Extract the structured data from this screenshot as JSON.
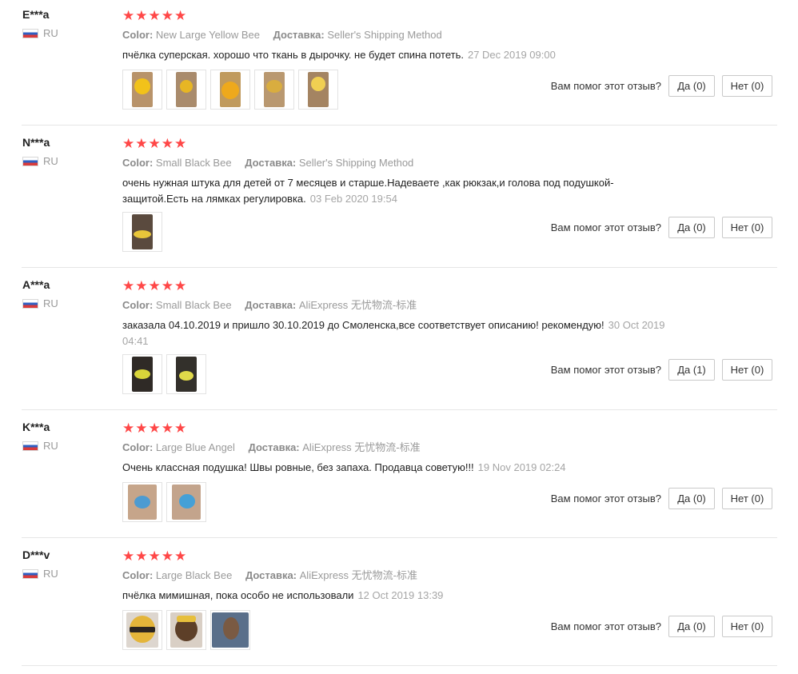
{
  "labels": {
    "color": "Color:",
    "shipping": "Доставка:",
    "helpful_question": "Вам помог этот отзыв?",
    "stars": "★★★★★"
  },
  "colors": {
    "star": "#ff4747",
    "divider": "#e6e6e6",
    "muted": "#9a9a9a"
  },
  "reviews": [
    {
      "user": "E***a",
      "country": "RU",
      "color_value": "New Large Yellow Bee",
      "shipping_value": "Seller's Shipping Method",
      "text": "пчёлка суперская. хорошо что ткань в дырочку. не будет спина потеть.",
      "date": "27 Dec 2019 09:00",
      "yes": "Да (0)",
      "no": "Нет (0)",
      "photos": 5
    },
    {
      "user": "N***a",
      "country": "RU",
      "color_value": "Small Black Bee",
      "shipping_value": "Seller's Shipping Method",
      "text": "очень нужная штука для детей от 7 месяцев и старше.Надеваете ,как рюкзак,и голова под подушкой-защитой.Есть на лямках регулировка.",
      "date": "03 Feb 2020 19:54",
      "yes": "Да (0)",
      "no": "Нет (0)",
      "photos": 1
    },
    {
      "user": "A***a",
      "country": "RU",
      "color_value": "Small Black Bee",
      "shipping_value": "AliExpress 无忧物流-标准",
      "text": "заказала 04.10.2019 и пришло 30.10.2019 до Смоленска,все соответствует описанию! рекомендую!",
      "date": "30 Oct 2019 04:41",
      "yes": "Да (1)",
      "no": "Нет (0)",
      "photos": 2
    },
    {
      "user": "K***a",
      "country": "RU",
      "color_value": "Large Blue Angel",
      "shipping_value": "AliExpress 无忧物流-标准",
      "text": "Очень классная подушка! Швы ровные, без запаха. Продавца советую!!!",
      "date": "19 Nov 2019 02:24",
      "yes": "Да (0)",
      "no": "Нет (0)",
      "photos": 2
    },
    {
      "user": "D***v",
      "country": "RU",
      "color_value": "Large Black Bee",
      "shipping_value": "AliExpress 无忧物流-标准",
      "text": "пчёлка мимишная, пока особо не использовали",
      "date": "12 Oct 2019 13:39",
      "yes": "Да (0)",
      "no": "Нет (0)",
      "photos": 3
    }
  ]
}
